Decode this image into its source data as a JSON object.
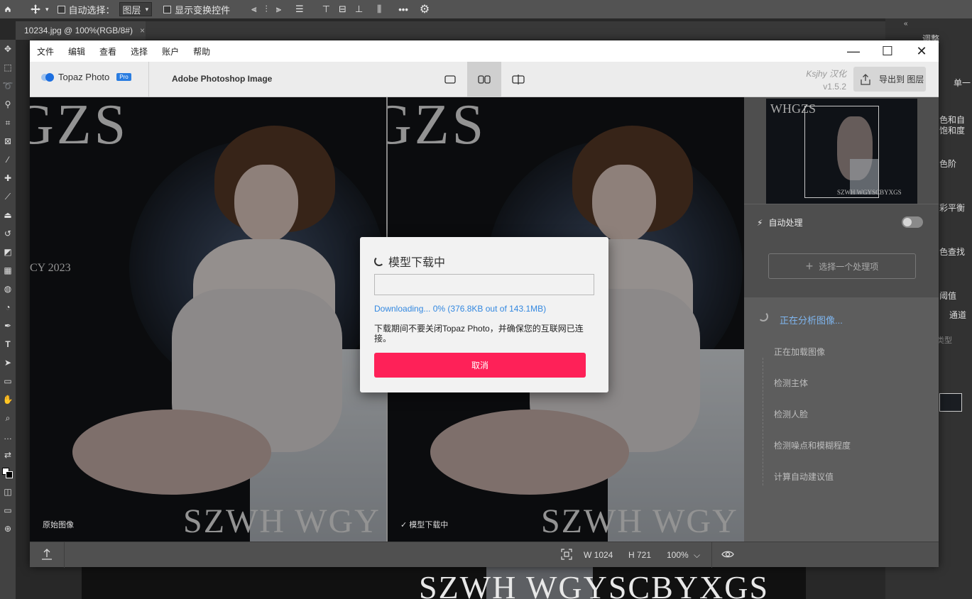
{
  "ps": {
    "toolbar": {
      "auto_select_label": "自动选择：",
      "auto_select_value": "图层",
      "show_transform_label": "显示变换控件",
      "more_label": "•••"
    },
    "tab": {
      "title": "10234.jpg @ 100%(RGB/8#)",
      "close": "×"
    },
    "right_panel": {
      "collapse": "«",
      "adjust_tab": "调整",
      "single_tab": "单一",
      "items": [
        "色和自",
        "饱和度",
        "色阶",
        "彩平衡",
        "色查找",
        "阈值"
      ],
      "channels_tab": "通道",
      "type_label": "类型"
    },
    "canvas_watermark": "SZWH WGYSCBYXGS"
  },
  "topaz": {
    "menu": [
      "文件",
      "编辑",
      "查看",
      "选择",
      "账户",
      "帮助"
    ],
    "window_controls": {
      "minimize": "—",
      "maximize": "☐",
      "close": "✕"
    },
    "logo_text": "Topaz Photo",
    "logo_badge": "Pro",
    "doc_title": "Adobe Photoshop Image",
    "credit_name": "Ksjhy 汉化",
    "credit_version": "v1.5.2",
    "export_label": "导出到 图层",
    "left_pane": {
      "watermark_top": "GZS",
      "watermark_mid": "CY 2023",
      "watermark_bottom": "SZWH WGY",
      "caption": "原始图像"
    },
    "right_pane": {
      "watermark_top": "GZS",
      "watermark_bottom": "SZWH WGY",
      "caption": "✓  模型下载中"
    },
    "navigator": {
      "title": "WHGZS",
      "footer": "SZWH WGYSCBYXGS"
    },
    "auto_process_label": "自动处理",
    "choose_label": "选择一个处理项",
    "analysis": {
      "heading": "正在分析图像...",
      "steps": [
        "正在加载图像",
        "检测主体",
        "检测人脸",
        "检测噪点和模糊程度",
        "计算自动建议值"
      ]
    },
    "footer": {
      "width": "W 1024",
      "height": "H 721",
      "zoom": "100%"
    }
  },
  "dialog": {
    "title": "模型下载中",
    "progress": 0.0,
    "status": "Downloading... 0% (376.8KB out of 143.1MB)",
    "note": "下载期间不要关闭Topaz Photo，并确保您的互联网已连接。",
    "cancel_label": "取消"
  },
  "colors": {
    "accent_blue": "#2a86e0",
    "cancel_red": "#fe2158"
  }
}
